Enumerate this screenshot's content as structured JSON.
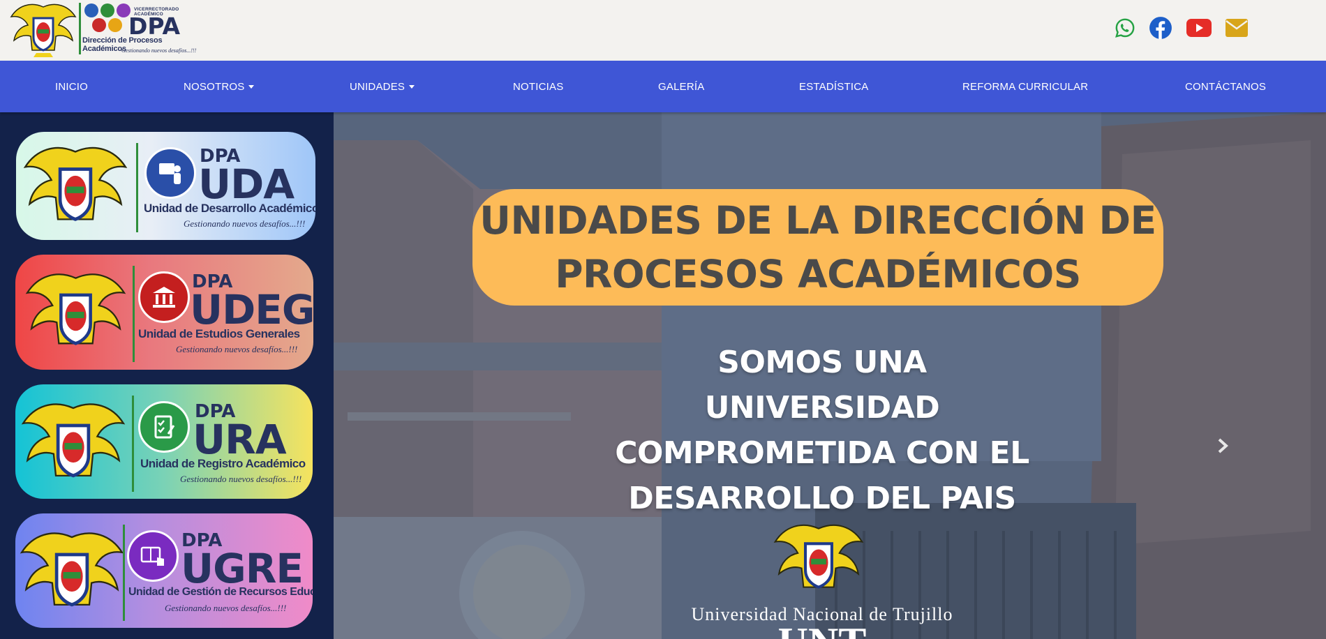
{
  "header": {
    "logo": {
      "vr_text": "VICERRECTORADO ACADÉMICO",
      "acronym": "DPA",
      "subtitle": "Dirección de Procesos Académicos",
      "tagline": "Gestionando nuevos desafíos...!!!"
    },
    "social": [
      {
        "name": "whatsapp",
        "icon": "whatsapp-icon",
        "color": "#25a244"
      },
      {
        "name": "facebook",
        "icon": "facebook-icon",
        "color": "#1d5fc9"
      },
      {
        "name": "youtube",
        "icon": "youtube-icon",
        "color": "#e52d27"
      },
      {
        "name": "email",
        "icon": "envelope-icon",
        "color": "#d8a51a"
      }
    ]
  },
  "nav": {
    "items": [
      {
        "label": "INICIO",
        "dropdown": false
      },
      {
        "label": "NOSOTROS",
        "dropdown": true
      },
      {
        "label": "UNIDADES",
        "dropdown": true
      },
      {
        "label": "NOTICIAS",
        "dropdown": false
      },
      {
        "label": "GALERÍA",
        "dropdown": false
      },
      {
        "label": "ESTADÍSTICA",
        "dropdown": false
      },
      {
        "label": "REFORMA CURRICULAR",
        "dropdown": false
      },
      {
        "label": "CONTÁCTANOS",
        "dropdown": false
      }
    ],
    "color": "#3f56d6"
  },
  "units": [
    {
      "dpa": "DPA",
      "acronym": "UDA",
      "name": "Unidad de Desarrollo Académico",
      "tagline": "Gestionando nuevos desafíos...!!!",
      "icon": "user-presenter-icon"
    },
    {
      "dpa": "DPA",
      "acronym": "UDEG",
      "name": "Unidad de Estudios Generales",
      "tagline": "Gestionando nuevos desafíos...!!!",
      "icon": "institution-icon"
    },
    {
      "dpa": "DPA",
      "acronym": "URA",
      "name": "Unidad de Registro Académico",
      "tagline": "Gestionando nuevos desafíos...!!!",
      "icon": "checklist-icon"
    },
    {
      "dpa": "DPA",
      "acronym": "UGRE",
      "name": "Unidad de Gestión de Recursos Educativos",
      "tagline": "Gestionando nuevos desafíos...!!!",
      "icon": "book-touch-icon"
    }
  ],
  "hero": {
    "title_line1": "UNIDADES DE LA DIRECCIÓN DE",
    "title_line2": "PROCESOS ACADÉMICOS",
    "slogan": "SOMOS UNA UNIVERSIDAD COMPROMETIDA CON EL DESARROLLO DEL PAIS",
    "university": "Universidad Nacional de Trujillo",
    "university_short": "UNT",
    "pill_color": "#fdbb58"
  }
}
